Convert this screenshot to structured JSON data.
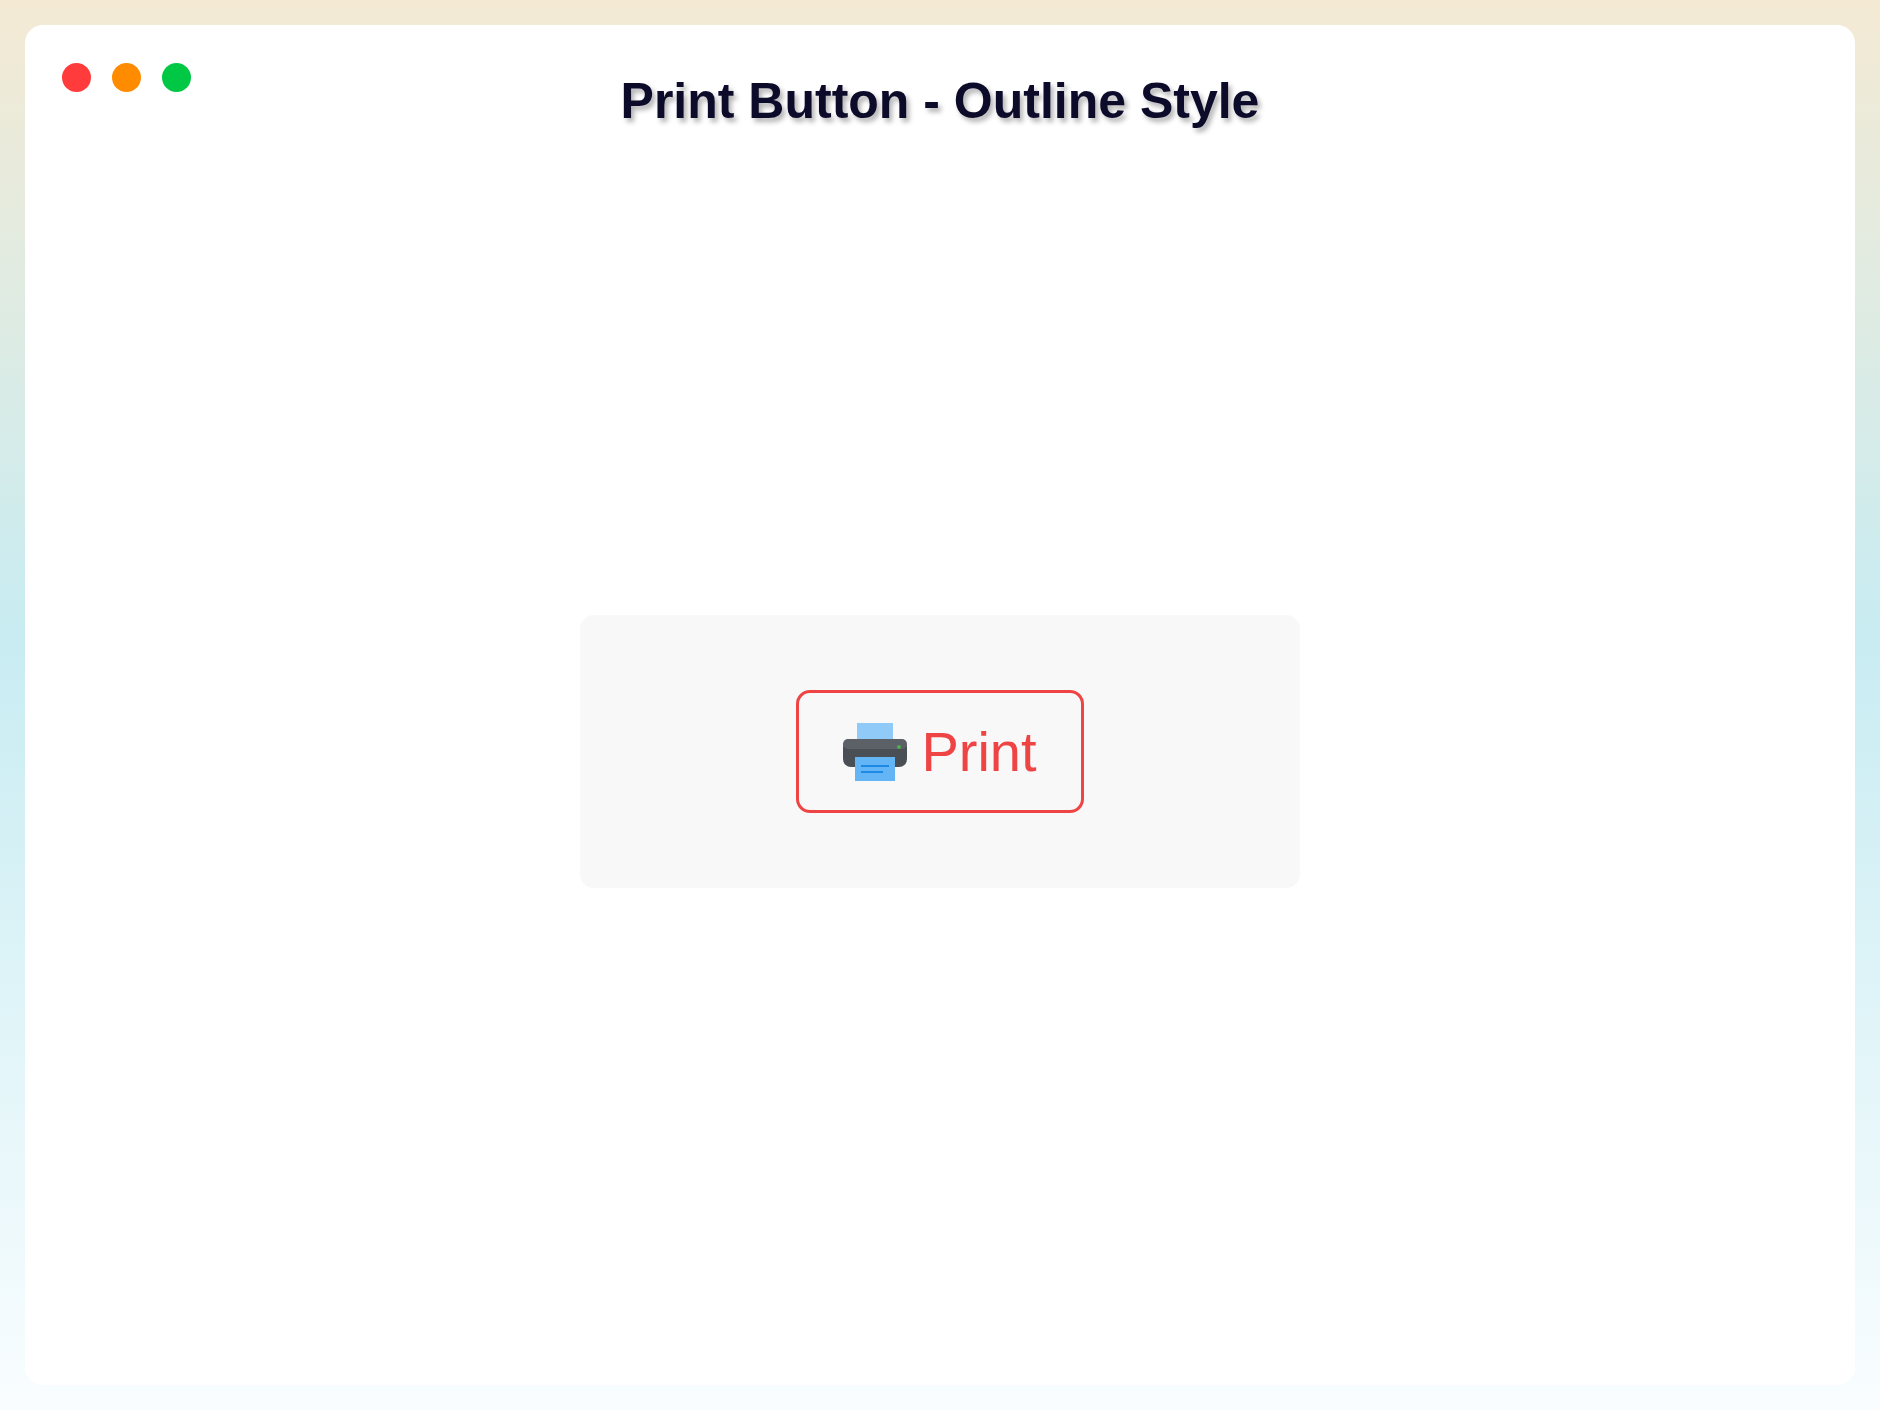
{
  "window": {
    "title": "Print Button - Outline Style",
    "controls": [
      {
        "color": "#ff3b3b"
      },
      {
        "color": "#ff8c00"
      },
      {
        "color": "#00c845"
      }
    ]
  },
  "button": {
    "label": "Print"
  }
}
